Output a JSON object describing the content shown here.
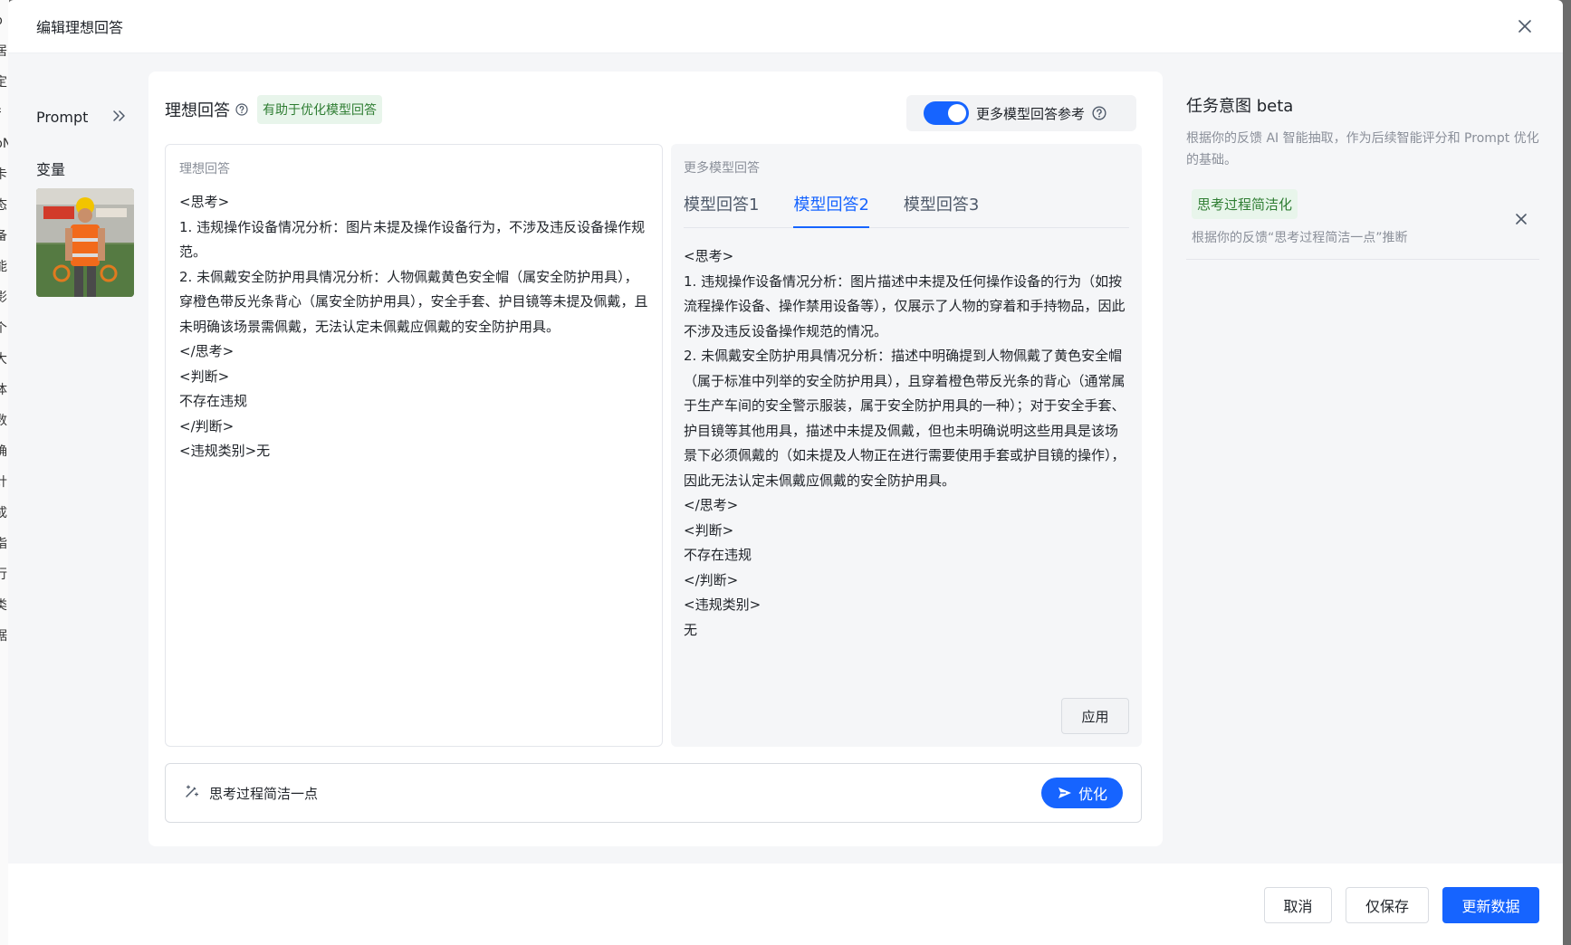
{
  "background_strip": [
    "p",
    "居",
    "定",
    "扌",
    "bN",
    "卡",
    "态",
    "备",
    "能",
    "影",
    "个",
    "大",
    "体",
    "数",
    "确",
    "针",
    "成",
    "指",
    "行",
    "类",
    "据"
  ],
  "modal": {
    "title": "编辑理想回答"
  },
  "left": {
    "prompt_label": "Prompt",
    "variables_label": "变量"
  },
  "center": {
    "title": "理想回答",
    "tag": "有助于优化模型回答",
    "toggle_label": "更多模型回答参考",
    "toggle_on": true,
    "ideal_caption": "理想回答",
    "ideal_text": "<思考>\n1. 违规操作设备情况分析：图片未提及操作设备行为，不涉及违反设备操作规范。\n2. 未佩戴安全防护用具情况分析：人物佩戴黄色安全帽（属安全防护用具），穿橙色带反光条背心（属安全防护用具），安全手套、护目镜等未提及佩戴，且未明确该场景需佩戴，无法认定未佩戴应佩戴的安全防护用具。\n</思考>\n<判断>\n不存在违规\n</判断>\n<违规类别>无",
    "more_caption": "更多模型回答",
    "tabs": [
      "模型回答1",
      "模型回答2",
      "模型回答3"
    ],
    "active_tab": 1,
    "more_text": "<思考>\n1. 违规操作设备情况分析：图片描述中未提及任何操作设备的行为（如按流程操作设备、操作禁用设备等），仅展示了人物的穿着和手持物品，因此不涉及违反设备操作规范的情况。\n2. 未佩戴安全防护用具情况分析：描述中明确提到人物佩戴了黄色安全帽（属于标准中列举的安全防护用具），且穿着橙色带反光条的背心（通常属于生产车间的安全警示服装，属于安全防护用具的一种）；对于安全手套、护目镜等其他用具，描述中未提及佩戴，但也未明确说明这些用具是该场景下必须佩戴的（如未提及人物正在进行需要使用手套或护目镜的操作），因此无法认定未佩戴应佩戴的安全防护用具。\n</思考>\n<判断>\n不存在违规\n</判断>\n<违规类别>\n无",
    "apply_label": "应用",
    "input_value": "思考过程简洁一点",
    "optimize_label": "优化"
  },
  "right": {
    "title": "任务意图 beta",
    "description": "根据你的反馈 AI 智能抽取，作为后续智能评分和 Prompt 优化的基础。",
    "intent_tag": "思考过程简洁化",
    "intent_desc": "根据你的反馈“思考过程简洁一点”推断"
  },
  "footer": {
    "cancel_label": "取消",
    "save_only_label": "仅保存",
    "update_label": "更新数据"
  },
  "colors": {
    "accent": "#1664ff",
    "tag_green_bg": "#e8f5eb",
    "tag_green_text": "#2e7d32"
  }
}
